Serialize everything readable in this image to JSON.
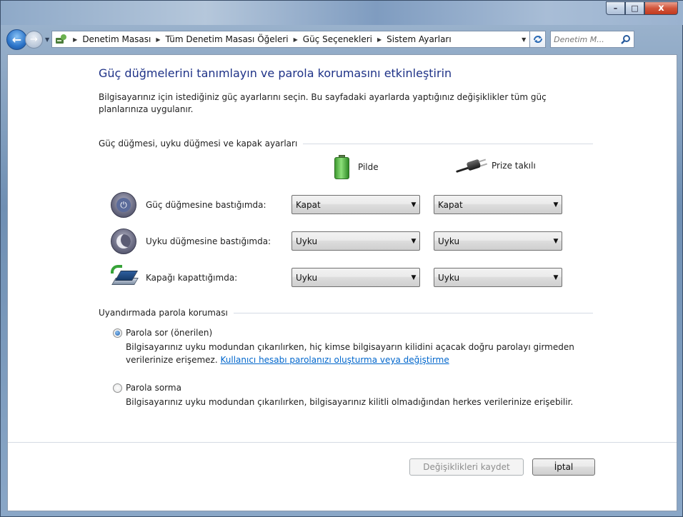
{
  "window": {
    "minimize_glyph": "–",
    "maximize_glyph": "□",
    "close_glyph": "x"
  },
  "navigation": {
    "back_glyph": "←",
    "forward_glyph": "→",
    "breadcrumbs": [
      "Denetim Masası",
      "Tüm Denetim Masası Öğeleri",
      "Güç Seçenekleri",
      "Sistem Ayarları"
    ],
    "search_placeholder": "Denetim M...",
    "icons": [
      "control-panel-icon",
      "refresh-icon",
      "search-icon"
    ]
  },
  "page": {
    "title": "Güç düğmelerini tanımlayın ve parola korumasını etkinleştirin",
    "intro": "Bilgisayarınız için istediğiniz güç ayarlarını seçin. Bu sayfadaki ayarlarda yaptığınız değişiklikler tüm güç planlarınıza uygulanır."
  },
  "power_section": {
    "heading": "Güç düğmesi, uyku düğmesi ve kapak ayarları",
    "columns": {
      "battery": "Pilde",
      "plugged": "Prize takılı"
    },
    "rows": [
      {
        "label": "Güç düğmesine bastığımda:",
        "battery": "Kapat",
        "plugged": "Kapat",
        "icon": "power-button-icon"
      },
      {
        "label": "Uyku düğmesine bastığımda:",
        "battery": "Uyku",
        "plugged": "Uyku",
        "icon": "sleep-button-icon"
      },
      {
        "label": "Kapağı kapattığımda:",
        "battery": "Uyku",
        "plugged": "Uyku",
        "icon": "laptop-lid-icon"
      }
    ]
  },
  "password_section": {
    "heading": "Uyandırmada parola koruması",
    "options": [
      {
        "label": "Parola sor (önerilen)",
        "selected": true,
        "description": "Bilgisayarınız uyku modundan çıkarılırken, hiç kimse bilgisayarın kilidini açacak doğru parolayı girmeden verilerinize erişemez.",
        "link": "Kullanıcı hesabı parolanızı oluşturma veya değiştirme"
      },
      {
        "label": "Parola sorma",
        "selected": false,
        "description": "Bilgisayarınız uyku modundan çıkarılırken, bilgisayarınız kilitli olmadığından herkes verilerinize erişebilir."
      }
    ]
  },
  "buttons": {
    "save": "Değişiklikleri kaydet",
    "save_enabled": false,
    "cancel": "İptal"
  },
  "colors": {
    "title": "#1e3287",
    "link": "#0066cc",
    "close_button": "#c23a1e"
  }
}
